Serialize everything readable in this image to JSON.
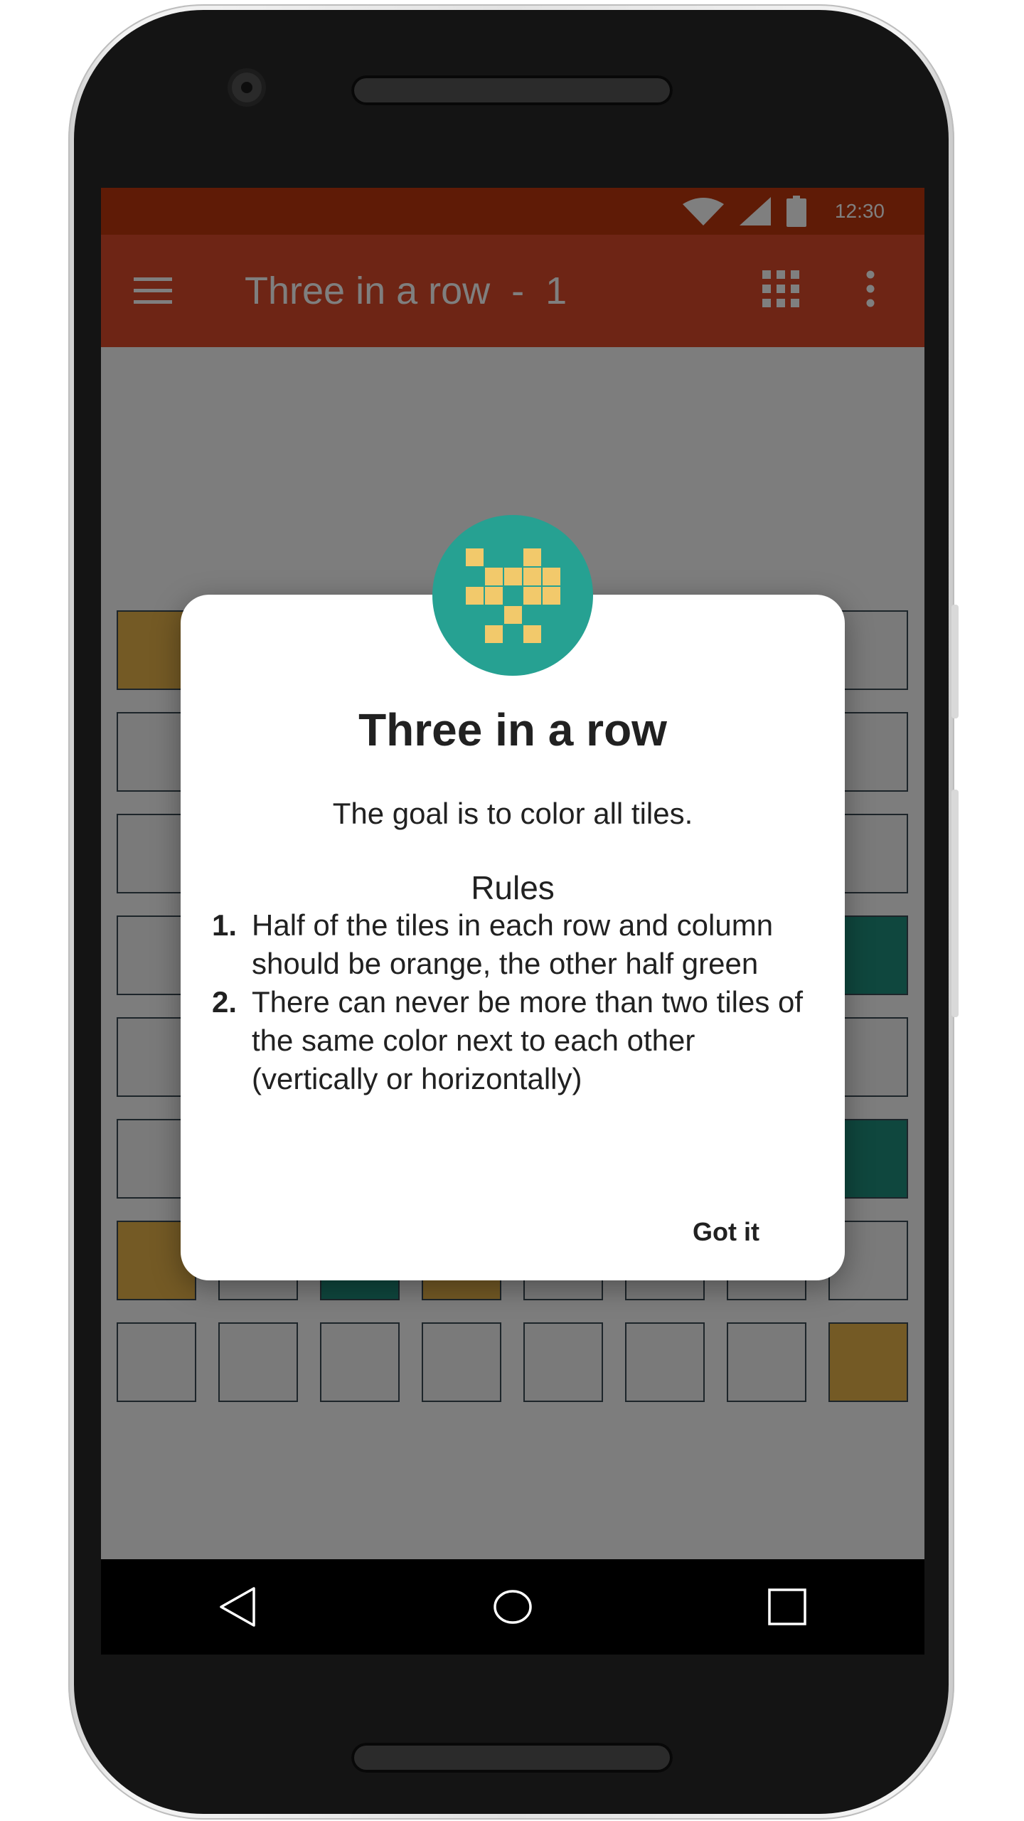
{
  "status_bar": {
    "time": "12:30",
    "icons": [
      "wifi-icon",
      "signal-icon",
      "battery-icon"
    ]
  },
  "app_bar": {
    "title": "Three in a row  -  1",
    "icons": [
      "menu-icon",
      "grid-icon",
      "more-vert-icon"
    ]
  },
  "board": {
    "rows": [
      [
        "orange",
        "empty",
        "empty",
        "empty",
        "empty",
        "empty",
        "empty",
        "empty"
      ],
      [
        "empty",
        "empty",
        "empty",
        "empty",
        "empty",
        "empty",
        "empty",
        "empty"
      ],
      [
        "empty",
        "empty",
        "empty",
        "empty",
        "empty",
        "empty",
        "empty",
        "empty"
      ],
      [
        "empty",
        "empty",
        "empty",
        "empty",
        "empty",
        "empty",
        "empty",
        "green"
      ],
      [
        "empty",
        "empty",
        "empty",
        "empty",
        "empty",
        "empty",
        "empty",
        "empty"
      ],
      [
        "empty",
        "empty",
        "empty",
        "empty",
        "empty",
        "empty",
        "empty",
        "green"
      ],
      [
        "orange",
        "empty",
        "green",
        "orange",
        "empty",
        "empty",
        "empty",
        "empty"
      ],
      [
        "empty",
        "empty",
        "empty",
        "empty",
        "empty",
        "empty",
        "empty",
        "orange"
      ]
    ],
    "colors": {
      "orange": "#e8b54a",
      "green": "#1f8e7d",
      "empty": "#f5f5f5"
    }
  },
  "dialog": {
    "title": "Three in a row",
    "goal": "The goal is to color all tiles.",
    "rules_heading": "Rules",
    "rules": [
      {
        "number": "1.",
        "text": "Half of the tiles in each row and column should be orange, the other half green"
      },
      {
        "number": "2.",
        "text": "There can never be more than two tiles of the same color next to each other (vertically or horizontally)"
      }
    ],
    "confirm_label": "Got it",
    "logo_icon": "tiles-logo-icon"
  },
  "nav_bar": {
    "icons": [
      "back-icon",
      "home-icon",
      "recents-icon"
    ]
  },
  "colors": {
    "status_bar": "#bf360c",
    "app_bar": "#dd4b2a",
    "logo_background": "#26a192",
    "logo_tiles": "#f2c96b"
  }
}
